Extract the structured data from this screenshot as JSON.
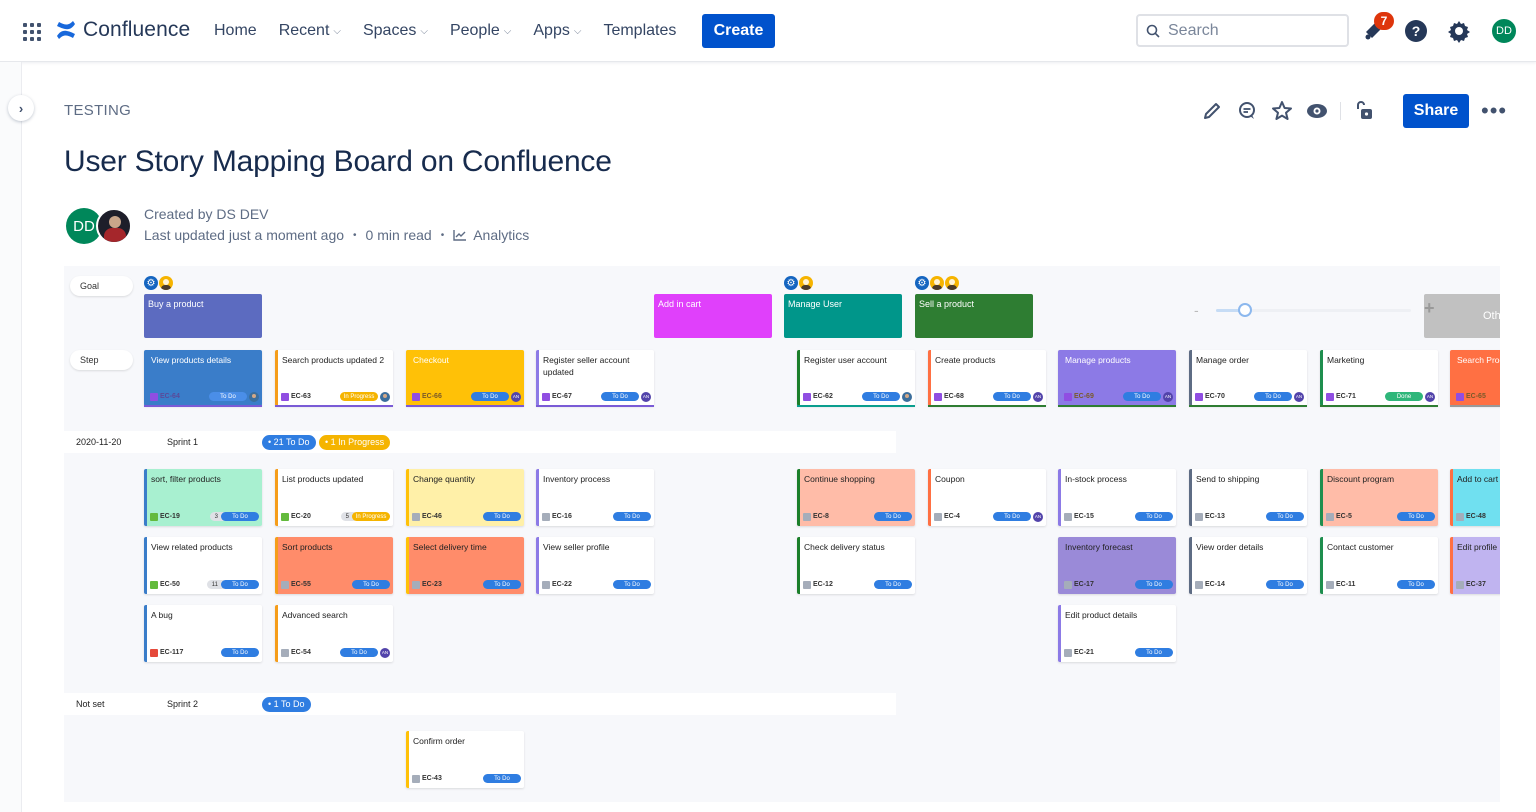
{
  "topnav": {
    "app_name": "Confluence",
    "items": [
      {
        "label": "Home",
        "dropdown": false
      },
      {
        "label": "Recent",
        "dropdown": true
      },
      {
        "label": "Spaces",
        "dropdown": true
      },
      {
        "label": "People",
        "dropdown": true
      },
      {
        "label": "Apps",
        "dropdown": true
      },
      {
        "label": "Templates",
        "dropdown": false
      }
    ],
    "create_label": "Create",
    "search_placeholder": "Search",
    "notification_count": "7",
    "help_glyph": "?",
    "user_initials": "DD"
  },
  "page": {
    "breadcrumb": "TESTING",
    "title": "User Story Mapping Board on Confluence",
    "share_label": "Share",
    "more_label": "•••",
    "created_by": "Created by DS DEV",
    "last_updated": "Last updated just a moment ago",
    "read_time": "0 min read",
    "analytics_label": "Analytics",
    "author_initials": "DD"
  },
  "board": {
    "row_labels": {
      "goal": "Goal",
      "step": "Step"
    },
    "goals": [
      {
        "title": "Buy a product",
        "color": "#5c6bc0",
        "icons": [
          "gear",
          "person"
        ]
      },
      {
        "title": "Add in cart",
        "color": "#e040fb",
        "icons": []
      },
      {
        "title": "Manage User",
        "color": "#00968a",
        "icons": [
          "gear",
          "person"
        ]
      },
      {
        "title": "Sell a product",
        "color": "#2e7d32",
        "icons": [
          "gear",
          "person",
          "person"
        ]
      }
    ],
    "zoom_level": 0.15,
    "others_label": "Others",
    "steps": [
      {
        "title": "View products details",
        "key": "EC-64",
        "type": "epic",
        "status": "To Do",
        "status_type": "todo",
        "assignee": "photo",
        "bg": "#3a7dc9",
        "left": "#3a7dc9",
        "under": "#7a5bd6"
      },
      {
        "title": "Search products updated 2",
        "key": "EC-63",
        "type": "epic",
        "status": "In Progress",
        "status_type": "prog",
        "assignee": "photo",
        "bg": "#ffffff",
        "left": "#f59d1a",
        "under": "#7a5bd6"
      },
      {
        "title": "Checkout",
        "key": "EC-66",
        "type": "epic",
        "status": "To Do",
        "status_type": "todo",
        "assignee": "AN",
        "bg": "#ffc107",
        "left": "#ffc107",
        "under": "#7a5bd6"
      },
      {
        "title": "Register seller account updated",
        "key": "EC-67",
        "type": "epic",
        "status": "To Do",
        "status_type": "todo",
        "assignee": "AN",
        "bg": "#ffffff",
        "left": "#8c7ae6",
        "under": "#7a5bd6"
      },
      {
        "title": "Register user account",
        "key": "EC-62",
        "type": "epic",
        "status": "To Do",
        "status_type": "todo",
        "assignee": "photo",
        "bg": "#ffffff",
        "left": "#1b7f2a",
        "under": "#0a9e8e"
      },
      {
        "title": "Create products",
        "key": "EC-68",
        "type": "epic",
        "status": "To Do",
        "status_type": "todo",
        "assignee": "AN",
        "bg": "#ffffff",
        "left": "#ff7043",
        "under": "#2e7d32"
      },
      {
        "title": "Manage products",
        "key": "EC-69",
        "type": "epic",
        "status": "To Do",
        "status_type": "todo",
        "assignee": "AN",
        "bg": "#8c7ae6",
        "left": "#8c7ae6",
        "under": "#2e7d32"
      },
      {
        "title": "Manage order",
        "key": "EC-70",
        "type": "epic",
        "status": "To Do",
        "status_type": "todo",
        "assignee": "AN",
        "bg": "#ffffff",
        "left": "#5e6c84",
        "under": "#2e7d32"
      },
      {
        "title": "Marketing",
        "key": "EC-71",
        "type": "epic",
        "status": "Done",
        "status_type": "done",
        "assignee": "AN",
        "bg": "#ffffff",
        "left": "#1e8e4e",
        "under": "#2e7d32"
      },
      {
        "title": "Search Products",
        "key": "EC-65",
        "type": "epic",
        "status": "",
        "status_type": "",
        "assignee": "",
        "bg": "#ff7043",
        "left": "#ff7043",
        "under": "#999999"
      }
    ],
    "sprints": [
      {
        "date": "2020-11-20",
        "name": "Sprint 1",
        "pills": [
          {
            "label": "• 21 To Do",
            "type": "todo"
          },
          {
            "label": "• 1 In Progress",
            "type": "prog"
          }
        ],
        "cards": [
          {
            "col": 0,
            "row": 0,
            "title": "sort, filter products",
            "key": "EC-19",
            "type": "story",
            "estimate": "3",
            "status": "To Do",
            "status_type": "todo",
            "bg": "#a8f0d0",
            "left": "#3a7dc9"
          },
          {
            "col": 1,
            "row": 0,
            "title": "List products updated",
            "key": "EC-20",
            "type": "story",
            "estimate": "5",
            "status": "In Progress",
            "status_type": "prog",
            "bg": "#ffffff",
            "left": "#f59d1a"
          },
          {
            "col": 2,
            "row": 0,
            "title": "Change quantity",
            "key": "EC-46",
            "type": "task",
            "status": "To Do",
            "status_type": "todo",
            "bg": "#fff0a8",
            "left": "#ffc107"
          },
          {
            "col": 3,
            "row": 0,
            "title": "Inventory process",
            "key": "EC-16",
            "type": "task",
            "status": "To Do",
            "status_type": "todo",
            "bg": "#ffffff",
            "left": "#8c7ae6"
          },
          {
            "col": 5,
            "row": 0,
            "title": "Continue shopping",
            "key": "EC-8",
            "type": "task",
            "status": "To Do",
            "status_type": "todo",
            "bg": "#ffbca8",
            "left": "#1b7f2a"
          },
          {
            "col": 6,
            "row": 0,
            "title": "Coupon",
            "key": "EC-4",
            "type": "task",
            "status": "To Do",
            "status_type": "todo",
            "assignee": "AN",
            "bg": "#ffffff",
            "left": "#ff7043"
          },
          {
            "col": 7,
            "row": 0,
            "title": "In-stock process",
            "key": "EC-15",
            "type": "task",
            "status": "To Do",
            "status_type": "todo",
            "bg": "#ffffff",
            "left": "#8c7ae6"
          },
          {
            "col": 8,
            "row": 0,
            "title": "Send to shipping",
            "key": "EC-13",
            "type": "task",
            "status": "To Do",
            "status_type": "todo",
            "bg": "#ffffff",
            "left": "#5e6c84"
          },
          {
            "col": 9,
            "row": 0,
            "title": "Discount program",
            "key": "EC-5",
            "type": "task",
            "status": "To Do",
            "status_type": "todo",
            "bg": "#ffbca8",
            "left": "#1e8e4e"
          },
          {
            "col": 10,
            "row": 0,
            "title": "Add to cart",
            "key": "EC-48",
            "type": "task",
            "status": "",
            "status_type": "",
            "bg": "#70e0f0",
            "left": "#ff7043"
          },
          {
            "col": 0,
            "row": 1,
            "title": "View related products",
            "key": "EC-50",
            "type": "story",
            "estimate": "11",
            "status": "To Do",
            "status_type": "todo",
            "bg": "#ffffff",
            "left": "#3a7dc9"
          },
          {
            "col": 1,
            "row": 1,
            "title": "Sort products",
            "key": "EC-55",
            "type": "task",
            "status": "To Do",
            "status_type": "todo",
            "bg": "#ff8c6a",
            "left": "#f59d1a"
          },
          {
            "col": 2,
            "row": 1,
            "title": "Select delivery time",
            "key": "EC-23",
            "type": "task",
            "status": "To Do",
            "status_type": "todo",
            "bg": "#ff8c6a",
            "left": "#ffc107"
          },
          {
            "col": 3,
            "row": 1,
            "title": "View seller profile",
            "key": "EC-22",
            "type": "task",
            "status": "To Do",
            "status_type": "todo",
            "bg": "#ffffff",
            "left": "#8c7ae6"
          },
          {
            "col": 5,
            "row": 1,
            "title": "Check delivery status",
            "key": "EC-12",
            "type": "task",
            "status": "To Do",
            "status_type": "todo",
            "bg": "#ffffff",
            "left": "#1b7f2a"
          },
          {
            "col": 7,
            "row": 1,
            "title": "Inventory forecast",
            "key": "EC-17",
            "type": "task",
            "status": "To Do",
            "status_type": "todo",
            "bg": "#9a8ad8",
            "left": "#9a8ad8"
          },
          {
            "col": 8,
            "row": 1,
            "title": "View order details",
            "key": "EC-14",
            "type": "task",
            "status": "To Do",
            "status_type": "todo",
            "bg": "#ffffff",
            "left": "#5e6c84"
          },
          {
            "col": 9,
            "row": 1,
            "title": "Contact customer",
            "key": "EC-11",
            "type": "task",
            "status": "To Do",
            "status_type": "todo",
            "bg": "#ffffff",
            "left": "#1e8e4e"
          },
          {
            "col": 10,
            "row": 1,
            "title": "Edit profile",
            "key": "EC-37",
            "type": "task",
            "status": "",
            "status_type": "",
            "bg": "#c0b4f0",
            "left": "#ff7043"
          },
          {
            "col": 0,
            "row": 2,
            "title": "A bug",
            "key": "EC-117",
            "type": "bug",
            "status": "To Do",
            "status_type": "todo",
            "bg": "#ffffff",
            "left": "#3a7dc9"
          },
          {
            "col": 1,
            "row": 2,
            "title": "Advanced search",
            "key": "EC-54",
            "type": "task",
            "status": "To Do",
            "status_type": "todo",
            "assignee": "AN",
            "bg": "#ffffff",
            "left": "#f59d1a"
          },
          {
            "col": 7,
            "row": 2,
            "title": "Edit product details",
            "key": "EC-21",
            "type": "task",
            "status": "To Do",
            "status_type": "todo",
            "bg": "#ffffff",
            "left": "#8c7ae6"
          }
        ]
      },
      {
        "date": "Not set",
        "name": "Sprint 2",
        "pills": [
          {
            "label": "• 1 To Do",
            "type": "todo"
          }
        ],
        "cards": [
          {
            "col": 2,
            "row": 0,
            "title": "Confirm order",
            "key": "EC-43",
            "type": "task",
            "status": "To Do",
            "status_type": "todo",
            "bg": "#ffffff",
            "left": "#ffc107"
          }
        ]
      }
    ]
  }
}
